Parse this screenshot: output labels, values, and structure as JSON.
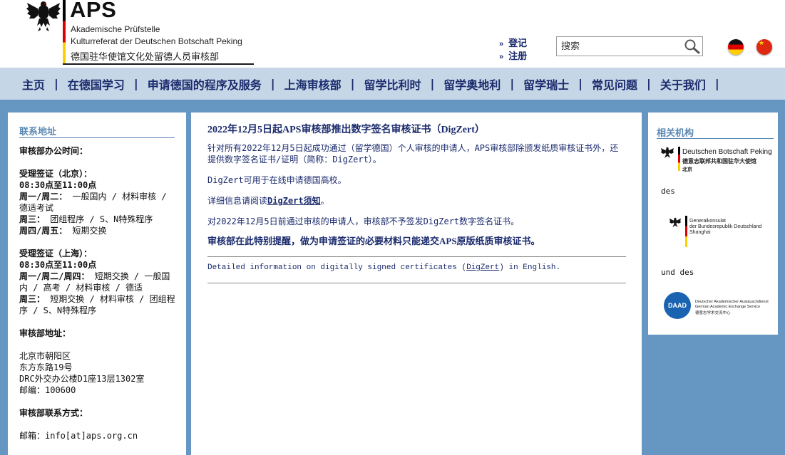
{
  "header": {
    "logo": {
      "title": "APS",
      "line1": "Akademische Prüfstelle",
      "line2": "Kulturreferat der Deutschen Botschaft Peking",
      "line3": "德国驻华使馆文化处留德人员审核部"
    },
    "auth": {
      "login_label": "登记",
      "register_label": "注册"
    },
    "search": {
      "placeholder": "搜索"
    },
    "languages": [
      "de",
      "zh"
    ]
  },
  "nav": {
    "items": [
      "主页",
      "在德国学习",
      "申请德国的程序及服务",
      "上海审核部",
      "留学比利时",
      "留学奥地利",
      "留学瑞士",
      "常见问题",
      "关于我们"
    ]
  },
  "left": {
    "title": "联系地址",
    "office_hours_title": "审核部办公时间：",
    "beijing": {
      "title": "受理签证（北京）：",
      "time": "08:30点至11:00点",
      "line1_day": "周一/周二：",
      "line1_text": "一般国内 / 材料审核 / 德适考试",
      "line2_day": "周三：",
      "line2_text": "团组程序 / S、N特殊程序",
      "line3_day": "周四/周五：",
      "line3_text": "短期交换"
    },
    "shanghai": {
      "title": "受理签证（上海）：",
      "time": "08:30点至11:00点",
      "line1_day": "周一/周二/周四：",
      "line1_text": "短期交换 / 一般国内 / 高考 / 材料审核 / 德适",
      "line2_day": "周三：",
      "line2_text": "短期交换 / 材料审核 / 团组程序 / S、N特殊程序"
    },
    "address_title": "审核部地址：",
    "address": [
      "北京市朝阳区",
      "东方东路19号",
      "DRC外交办公楼D1座13层1302室",
      "邮编：100600"
    ],
    "contact_title": "审核部联系方式：",
    "email": "邮箱：info[at]aps.org.cn"
  },
  "article": {
    "title": "2022年12月5日起APS审核部推出数字签名审核证书（DigZert）",
    "p1": "针对所有2022年12月5日起成功通过（留学德国）个人审核的申请人，APS审核部除颁发纸质审核证书外，还提供数字签名证书/证明（简称：DigZert）。",
    "p2": "DigZert可用于在线申请德国高校。",
    "p3_prefix": "详细信息请阅读",
    "p3_link": "DigZert须知",
    "p3_suffix": "。",
    "p4": "对2022年12月5日前通过审核的申请人，审核部不予签发DigZert数字签名证书。",
    "p5": "审核部在此特别提醒，做为申请签证的必要材料只能递交APS原版纸质审核证书。",
    "en_prefix": "Detailed information on digitally signed certificates (",
    "en_link": "DigZert",
    "en_suffix": ") in English."
  },
  "right": {
    "title": "相关机构",
    "embassy": {
      "name": "Deutschen Botschaft Peking",
      "name_cn": "德意志联邦共和国驻华大使馆",
      "city": "北京"
    },
    "sep1": "des",
    "consulate": {
      "line1": "Generalkonsulat",
      "line2": "der Bundesrepublik Deutschland",
      "line3": "Shanghai"
    },
    "sep2": "und des",
    "daad": {
      "abbr": "DAAD",
      "line1": "Deutscher Akademischer Austauschdienst",
      "line2": "German Academic Exchange Service",
      "line3": "德意志学术交流中心"
    }
  },
  "colors": {
    "nav_bg": "#c5d6e6",
    "page_bg": "#6697c3",
    "navy_text": "#1a2a6c",
    "panel_title": "#5b88b4"
  }
}
